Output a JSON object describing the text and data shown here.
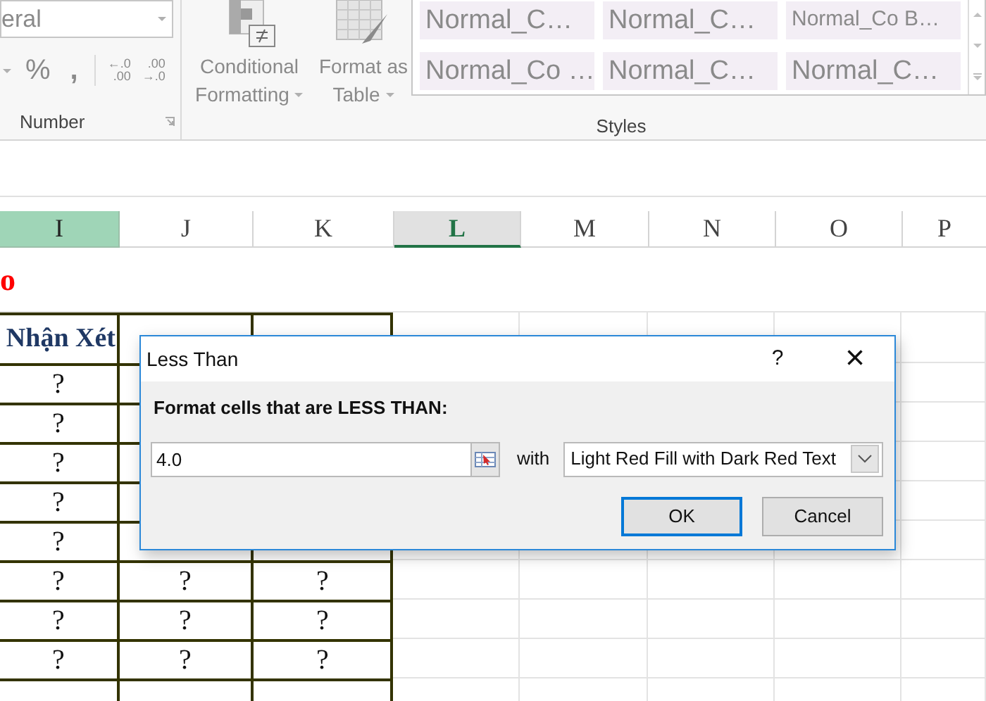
{
  "ribbon": {
    "number_format": {
      "value": "eral"
    },
    "number_symbols": [
      "%",
      ","
    ],
    "decimal_buttons": [
      {
        "top": "←.0",
        "bottom": ".00"
      },
      {
        "top": ".00",
        "bottom": "→.0"
      }
    ],
    "number_label": "Number",
    "conditional_formatting": {
      "line1": "Conditional",
      "line2": "Formatting"
    },
    "format_as_table": {
      "line1": "Format as",
      "line2": "Table"
    },
    "styles": [
      {
        "label": "Normal_C…",
        "kind": "large"
      },
      {
        "label": "Normal_C…",
        "kind": "large"
      },
      {
        "label": "Normal_Co B…",
        "kind": "small"
      },
      {
        "label": "Normal_Co …",
        "kind": "large"
      },
      {
        "label": "Normal_C…",
        "kind": "large"
      },
      {
        "label": "Normal_C…",
        "kind": "large"
      }
    ],
    "styles_label": "Styles"
  },
  "sheet": {
    "columns": [
      {
        "label": "I",
        "selected": true,
        "active": false
      },
      {
        "label": "J",
        "selected": false,
        "active": false
      },
      {
        "label": "K",
        "selected": false,
        "active": false
      },
      {
        "label": "L",
        "selected": false,
        "active": true
      },
      {
        "label": "M",
        "selected": false,
        "active": false
      },
      {
        "label": "N",
        "selected": false,
        "active": false
      },
      {
        "label": "O",
        "selected": false,
        "active": false
      },
      {
        "label": "P",
        "selected": false,
        "active": false
      }
    ],
    "title_fragment": {
      "text": "o",
      "color": "#ff0000"
    },
    "header": [
      "Nhận Xét"
    ],
    "rows": [
      [
        "?"
      ],
      [
        "?"
      ],
      [
        "?"
      ],
      [
        "?"
      ],
      [
        "?"
      ],
      [
        "?",
        "?",
        "?"
      ],
      [
        "?",
        "?",
        "?"
      ],
      [
        "?",
        "?",
        "?"
      ]
    ]
  },
  "dialog": {
    "title": "Less Than",
    "help": "?",
    "close": "×",
    "prompt": "Format cells that are LESS THAN:",
    "value": "4.0",
    "with_label": "with",
    "format": "Light Red Fill with Dark Red Text",
    "buttons": [
      {
        "label": "OK",
        "selected": true
      },
      {
        "label": "Cancel",
        "selected": false
      }
    ]
  }
}
